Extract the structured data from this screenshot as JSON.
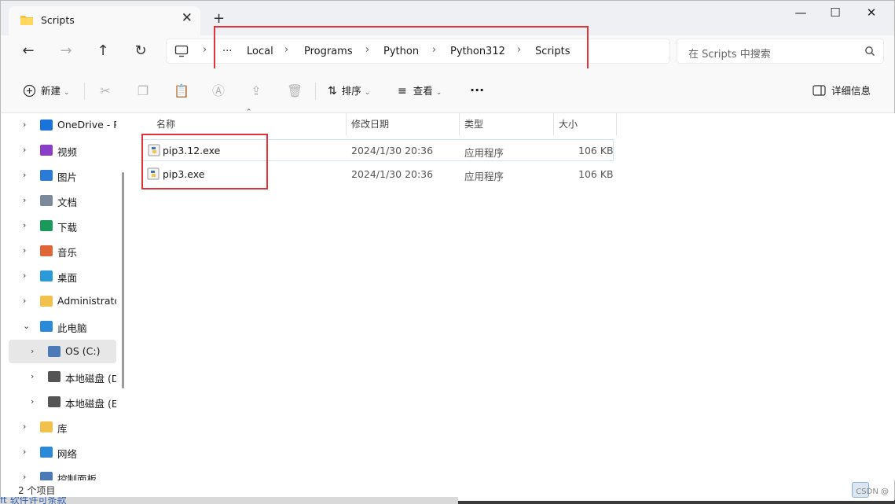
{
  "tab": {
    "title": "Scripts",
    "close": "✕",
    "new": "+"
  },
  "window_controls": {
    "minimize": "—",
    "maximize": "☐",
    "close": "✕"
  },
  "nav": {
    "back": "←",
    "forward": "→",
    "up": "↑",
    "refresh": "↻",
    "more": "···",
    "breadcrumbs": [
      "Local",
      "Programs",
      "Python",
      "Python312",
      "Scripts"
    ],
    "separator": "›",
    "search_placeholder": "在 Scripts 中搜索"
  },
  "toolbar": {
    "new_label": "新建",
    "sort_label": "排序",
    "view_label": "查看",
    "more": "···",
    "details_label": "详细信息"
  },
  "sidebar": {
    "items": [
      {
        "label": "OneDrive - Pe",
        "icon": "cloud-icon",
        "color": "#1a73d9"
      },
      {
        "label": "视频",
        "icon": "video-icon",
        "color": "#8a3ec8"
      },
      {
        "label": "图片",
        "icon": "picture-icon",
        "color": "#2a7bd8"
      },
      {
        "label": "文档",
        "icon": "document-icon",
        "color": "#7a8a9a"
      },
      {
        "label": "下载",
        "icon": "download-icon",
        "color": "#1a9a5a"
      },
      {
        "label": "音乐",
        "icon": "music-icon",
        "color": "#e0663a"
      },
      {
        "label": "桌面",
        "icon": "desktop-icon",
        "color": "#2a9ad8"
      },
      {
        "label": "Administrator",
        "icon": "folder-icon",
        "color": "#f2c14b"
      },
      {
        "label": "此电脑",
        "icon": "pc-icon",
        "color": "#2a8ad8"
      },
      {
        "label": "OS (C:)",
        "icon": "drive-c-icon",
        "color": "#4a7ab8"
      },
      {
        "label": "本地磁盘 (D:",
        "icon": "drive-icon",
        "color": "#555555"
      },
      {
        "label": "本地磁盘 (E:)",
        "icon": "drive-icon",
        "color": "#555555"
      },
      {
        "label": "库",
        "icon": "library-icon",
        "color": "#f2c14b"
      },
      {
        "label": "网络",
        "icon": "network-icon",
        "color": "#2a8ad8"
      },
      {
        "label": "控制面板",
        "icon": "control-panel-icon",
        "color": "#4a7ab8"
      }
    ]
  },
  "columns": [
    "名称",
    "修改日期",
    "类型",
    "大小"
  ],
  "files": [
    {
      "name": "pip3.12.exe",
      "modified": "2024/1/30 20:36",
      "type": "应用程序",
      "size": "106 KB"
    },
    {
      "name": "pip3.exe",
      "modified": "2024/1/30 20:36",
      "type": "应用程序",
      "size": "106 KB"
    }
  ],
  "status": {
    "count": "2 个项目"
  },
  "background_text": "ft 软件许可条款",
  "watermark": "CSDN @",
  "colors": {
    "highlight_box": "#e0333a",
    "accent": "#0067c0"
  }
}
